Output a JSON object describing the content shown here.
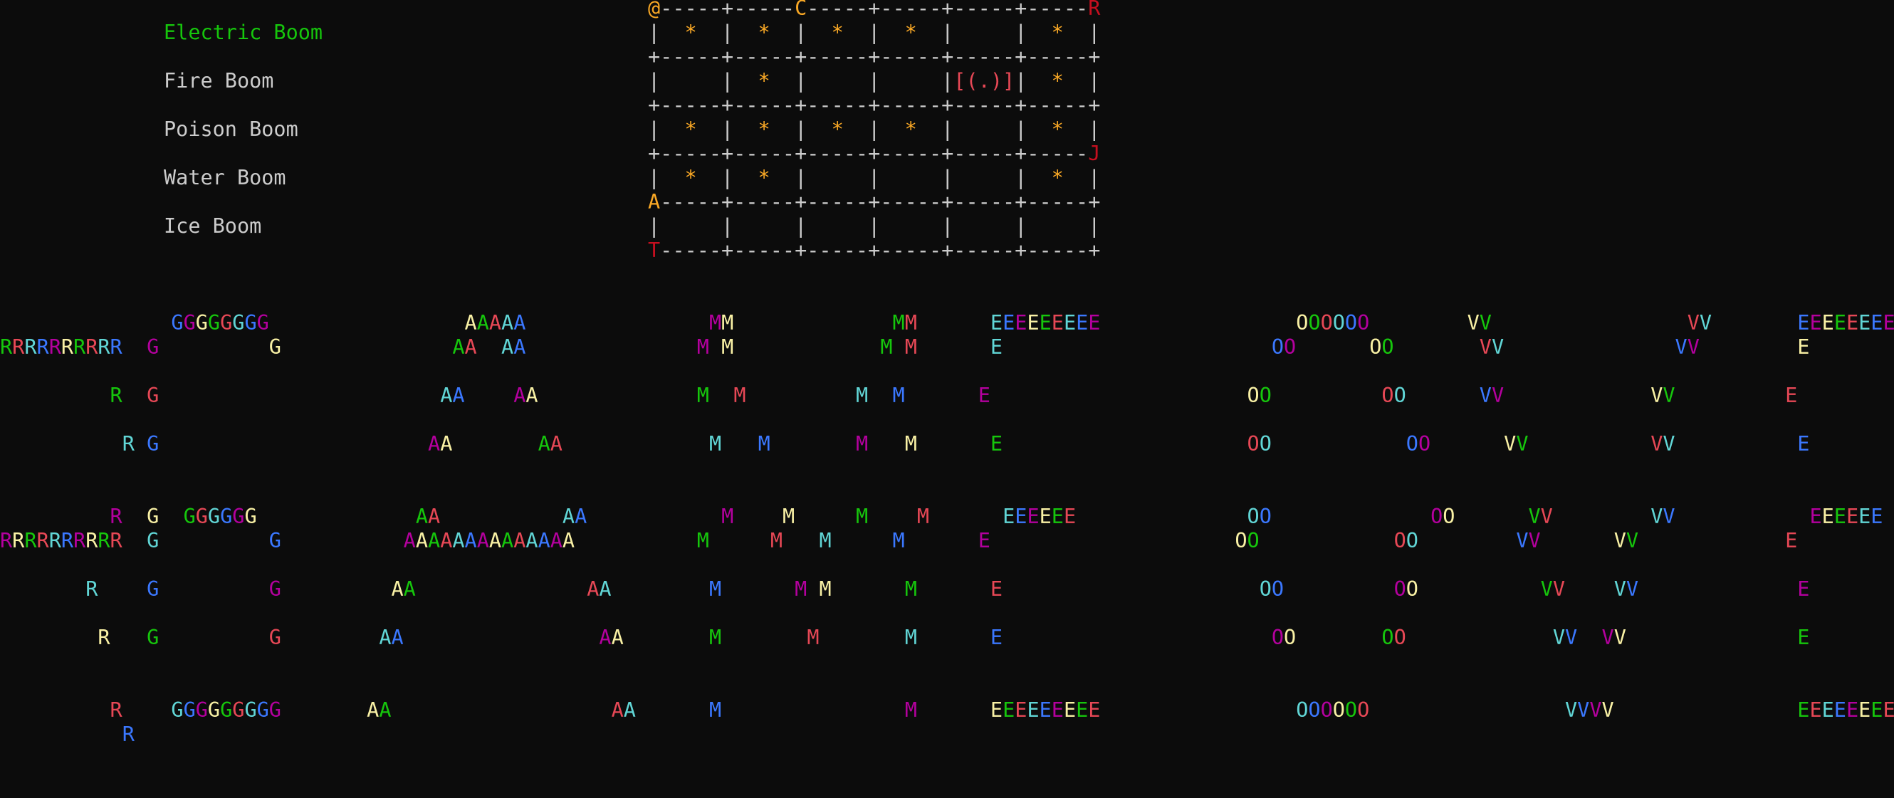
{
  "colors": {
    "default": "#cccccc",
    "green": "#16c60c",
    "red": "#e74856",
    "darkred": "#c50f1f",
    "orange": "#f9a825",
    "blue": "#3b78ff",
    "magenta": "#b4009e",
    "cyan": "#61d6d6",
    "yellow": "#f9f1a5",
    "background": "#0c0c0c"
  },
  "menu": {
    "items": [
      {
        "label": "Electric Boom",
        "selected": true
      },
      {
        "label": "Fire Boom",
        "selected": false
      },
      {
        "label": "Poison Boom",
        "selected": false
      },
      {
        "label": "Water Boom",
        "selected": false
      },
      {
        "label": "Ice Boom",
        "selected": false
      }
    ]
  },
  "board": {
    "rows": [
      "@-----+-----C-----+-----+-----+-----R",
      "|  *  |  *  |  *  |  *  |     |  *  |",
      "+-----+-----+-----+-----+-----+-----+",
      "|     |  *  |     |     |[(.)]|  *  |",
      "+-----+-----+-----+-----+-----+-----+",
      "|  *  |  *  |  *  |  *  |     |  *  |",
      "+-----+-----+-----+-----+-----+-----J",
      "|  *  |  *  |     |     |     |  *  |",
      "A-----+-----+-----+-----+-----+-----+",
      "|     |     |     |     |     |     |",
      "T-----+-----+-----+-----+-----+-----+"
    ]
  },
  "banner": {
    "rows": [
      "              GGGGGGGG                AAAAA               MM             MM      EEEEEEEEE                OOOOOO        VV                VV       EEEEEEEEE",
      "RRRRRRRRRR  G         G              AA  AA              M M            M M      E                      OO      OO       VV              VV        E",
      "         R  G                       AA    AA             M  M         M  M      E                     OO         OO      VV            VV         E",
      "          R G                      AA       AA            M   M       M   M      E                    OO           OO      VV          VV          E",
      "         R  G  GGGGGG             AA          AA           M    M     M    M      EEEEEE              OO             OO      VV        VV           EEEEEE",
      "RRRRRRRRRR  G         G          AAAAAAAAAAAAAA          M     M   M     M      E                    OO           OO        VV      VV            E",
      "       R    G         G         AA              AA        M      M M      M      E                     OO         OO          VV    VV             E",
      "        R   G         G        AA                AA       M       M       M      E                      OO       OO            VV  VV              E",
      "         R    GGGGGGGGG       AA                  AA      M               M      EEEEEEEEE                OOOOOO                VVVV               EEEEEEEEE",
      "          R"
    ]
  }
}
